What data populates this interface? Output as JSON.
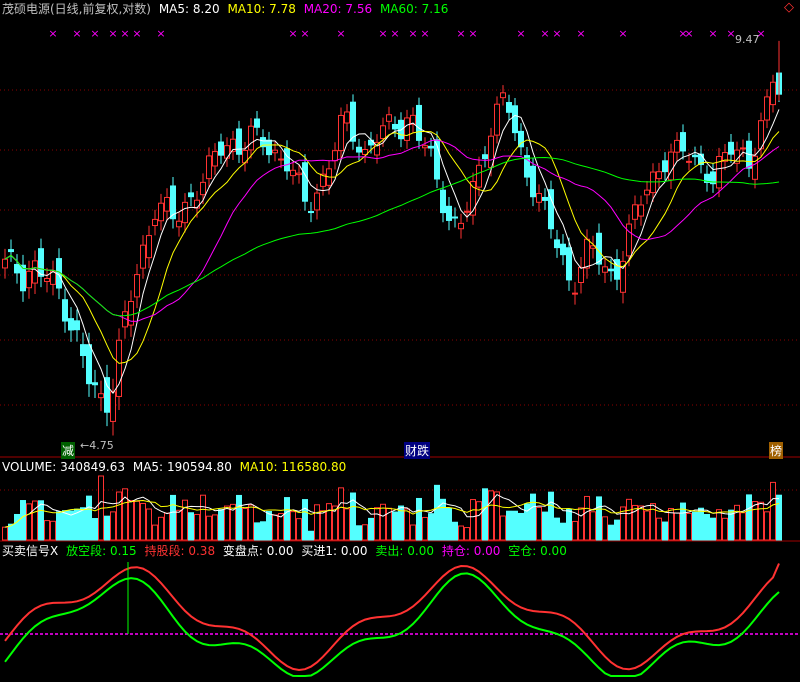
{
  "header": {
    "title": "茂硕电源(日线,前复权,对数)",
    "ma5_label": "MA5:",
    "ma5_value": "8.20",
    "ma10_label": "MA10:",
    "ma10_value": "7.78",
    "ma20_label": "MA20:",
    "ma20_value": "7.56",
    "ma60_label": "MA60:",
    "ma60_value": "7.16"
  },
  "volume_header": {
    "label": "VOLUME:",
    "value": "340849.63",
    "ma5_label": "MA5:",
    "ma5_value": "190594.80",
    "ma10_label": "MA10:",
    "ma10_value": "116580.80"
  },
  "indicator_header": {
    "name": "买卖信号X",
    "fangkong_label": "放空段:",
    "fangkong_value": "0.15",
    "chigu_label": "持股段:",
    "chigu_value": "0.38",
    "bianpan_label": "变盘点:",
    "bianpan_value": "0.00",
    "mairu_label": "买进1:",
    "mairu_value": "0.00",
    "maichu_label": "卖出:",
    "maichu_value": "0.00",
    "chicang_label": "持仓:",
    "chicang_value": "0.00",
    "kongcang_label": "空仓:",
    "kongcang_value": "0.00"
  },
  "markers": {
    "low_label": "←4.75",
    "high_label": "9.47",
    "tag_jian": "减",
    "tag_caibao": "财跌",
    "tag_bang": "榜",
    "signal_char": "×"
  },
  "colors": {
    "up": "#ff3232",
    "down": "#54ffff",
    "ma5": "#ffffff",
    "ma10": "#ffff00",
    "ma20": "#ff00ff",
    "ma60": "#00ff00",
    "grid": "#8b0000",
    "signal": "#ff00ff",
    "fangkong": "#00ff00",
    "chigu": "#ff3232"
  },
  "chart_data": {
    "type": "candlestick",
    "title": "茂硕电源(日线,前复权,对数)",
    "price_range": [
      4.75,
      9.47
    ],
    "low_price": 4.75,
    "high_price": 9.47,
    "moving_averages": {
      "MA5": 8.2,
      "MA10": 7.78,
      "MA20": 7.56,
      "MA60": 7.16
    },
    "close_price_path": [
      6.3,
      6.3,
      6.2,
      6.3,
      6.2,
      6.1,
      6.0,
      5.7,
      5.4,
      5.1,
      4.9,
      5.0,
      5.4,
      5.8,
      6.2,
      6.6,
      7.1,
      7.0,
      6.8,
      7.0,
      7.2,
      7.4,
      7.6,
      7.8,
      7.9,
      7.8,
      8.0,
      7.9,
      7.8,
      7.7,
      7.6,
      7.3,
      7.0,
      7.2,
      7.5,
      7.8,
      8.3,
      8.0,
      7.7,
      7.9,
      8.0,
      8.2,
      8.1,
      8.3,
      7.9,
      7.7,
      7.3,
      6.9,
      6.7,
      7.0,
      7.4,
      7.9,
      8.3,
      8.6,
      8.0,
      7.6,
      7.3,
      7.0,
      6.7,
      6.4,
      6.1,
      6.3,
      6.5,
      6.4,
      6.2,
      6.3,
      6.6,
      7.0,
      7.3,
      7.5,
      7.6,
      7.7,
      7.8,
      7.7,
      7.5,
      7.3,
      7.6,
      7.9,
      7.8,
      7.5,
      8.0,
      8.6,
      9.47
    ],
    "volume": {
      "value": 340849.63,
      "MA5": 190594.8,
      "MA10": 116580.8
    },
    "indicator": {
      "放空段": 0.15,
      "持股段": 0.38,
      "变盘点": 0.0,
      "买进1": 0.0,
      "卖出": 0.0,
      "持仓": 0.0,
      "空仓": 0.0
    },
    "grid": true
  }
}
